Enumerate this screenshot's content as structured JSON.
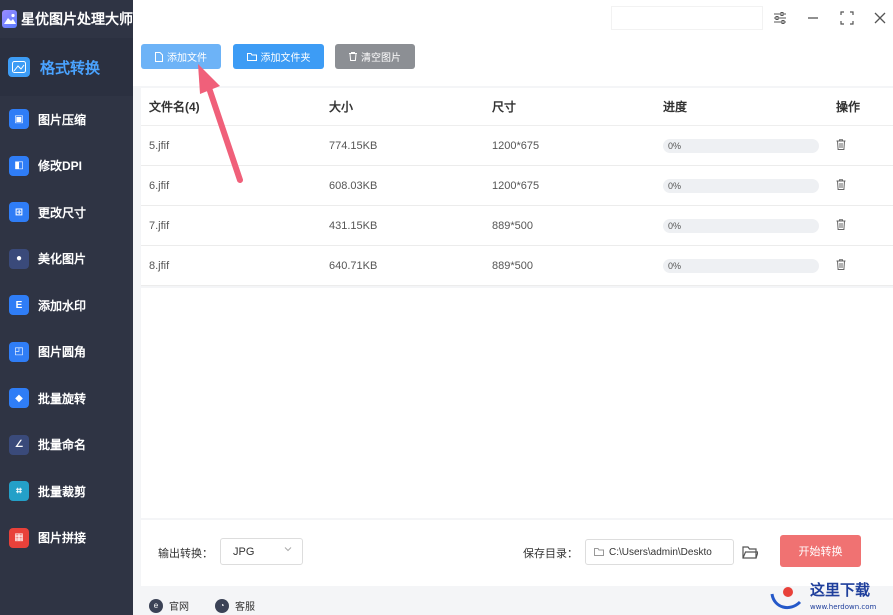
{
  "app": {
    "title": "星优图片处理大师"
  },
  "sidebar": {
    "active": {
      "label": "格式转换",
      "icon": "image-convert-icon"
    },
    "items": [
      {
        "label": "图片压缩",
        "icon": "compress-icon",
        "color": "#2f7df6"
      },
      {
        "label": "修改DPI",
        "icon": "dpi-icon",
        "color": "#2f7df6"
      },
      {
        "label": "更改尺寸",
        "icon": "resize-icon",
        "color": "#2f7df6"
      },
      {
        "label": "美化图片",
        "icon": "beautify-icon",
        "color": "#2f7df6"
      },
      {
        "label": "添加水印",
        "icon": "watermark-icon",
        "color": "#2f7df6"
      },
      {
        "label": "图片圆角",
        "icon": "round-corner-icon",
        "color": "#2f7df6"
      },
      {
        "label": "批量旋转",
        "icon": "rotate-icon",
        "color": "#2f7df6"
      },
      {
        "label": "批量命名",
        "icon": "rename-icon",
        "color": "#2f7df6"
      },
      {
        "label": "批量裁剪",
        "icon": "crop-icon",
        "color": "#2f7df6"
      },
      {
        "label": "图片拼接",
        "icon": "stitch-icon",
        "color": "#2f7df6"
      }
    ]
  },
  "toolbar": {
    "add_file": "添加文件",
    "add_folder": "添加文件夹",
    "clear": "清空图片"
  },
  "table": {
    "headers": {
      "name": "文件名(4)",
      "size": "大小",
      "dimension": "尺寸",
      "progress": "进度",
      "action": "操作"
    },
    "rows": [
      {
        "name": "5.jfif",
        "size": "774.15KB",
        "dimension": "1200*675",
        "progress": "0%"
      },
      {
        "name": "6.jfif",
        "size": "608.03KB",
        "dimension": "1200*675",
        "progress": "0%"
      },
      {
        "name": "7.jfif",
        "size": "431.15KB",
        "dimension": "889*500",
        "progress": "0%"
      },
      {
        "name": "8.jfif",
        "size": "640.71KB",
        "dimension": "889*500",
        "progress": "0%"
      }
    ]
  },
  "footer": {
    "output_label": "输出转换：",
    "output_value": "JPG",
    "save_label": "保存目录：",
    "save_path": "C:\\Users\\admin\\Deskto",
    "start_button": "开始转换"
  },
  "bottom": {
    "website": "官网",
    "support": "客服"
  },
  "watermark": {
    "text": "这里下载",
    "url_text": "www.herdown.com"
  },
  "colors": {
    "sidebar_bg": "#2f3444",
    "accent": "#3d9cf5",
    "start_button": "#f07272",
    "arrow": "#f0607a"
  }
}
